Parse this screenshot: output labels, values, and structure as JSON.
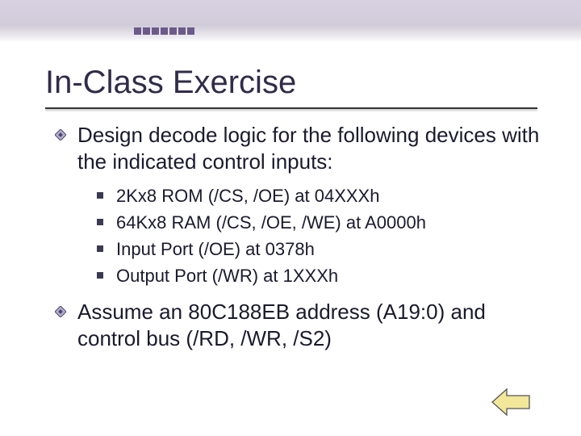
{
  "title": "In-Class Exercise",
  "bullet1": "Design decode logic for the following devices with the indicated control inputs:",
  "subs": {
    "s0": "2Kx8 ROM (/CS, /OE) at 04XXXh",
    "s1": "64Kx8 RAM (/CS, /OE, /WE) at A0000h",
    "s2": "Input Port (/OE) at 0378h",
    "s3": "Output Port (/WR) at 1XXXh"
  },
  "bullet2": "Assume an 80C188EB address (A19:0) and control bus (/RD, /WR, /S2)"
}
